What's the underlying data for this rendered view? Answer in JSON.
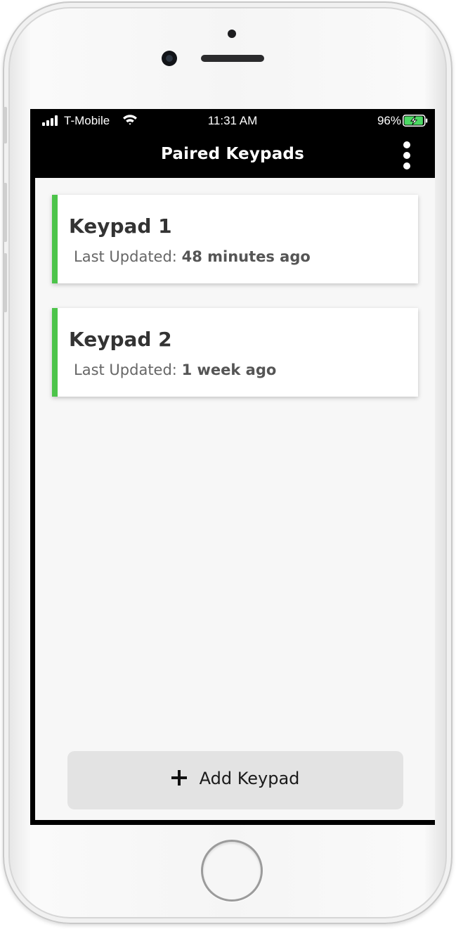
{
  "status_bar": {
    "carrier": "T-Mobile",
    "time": "11:31 AM",
    "battery_percent": "96%",
    "battery_level": 0.96,
    "battery_color": "#4cd964",
    "signal_icon": "cellular-signal-icon",
    "wifi_icon": "wifi-icon"
  },
  "header": {
    "title": "Paired Keypads",
    "menu_icon": "more-vertical-icon"
  },
  "keypads": [
    {
      "name": "Keypad 1",
      "updated_label": "Last Updated:",
      "updated_value": "48 minutes ago"
    },
    {
      "name": "Keypad 2",
      "updated_label": "Last Updated:",
      "updated_value": "1 week ago"
    }
  ],
  "footer": {
    "add_label": "Add Keypad",
    "add_icon": "plus-icon"
  },
  "colors": {
    "accent": "#4cc44a",
    "header_bg": "#000000",
    "content_bg": "#f7f7f7",
    "button_bg": "#e3e3e3"
  }
}
